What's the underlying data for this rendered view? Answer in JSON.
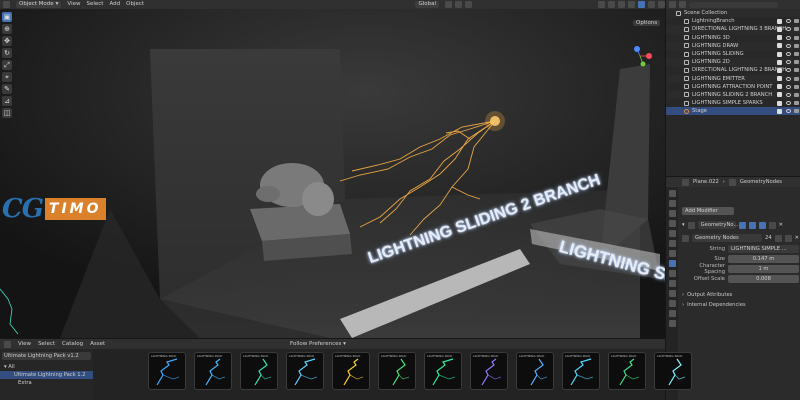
{
  "header": {
    "mode": "Object Mode",
    "menus": [
      "View",
      "Select",
      "Add",
      "Object"
    ],
    "orientation": "Global",
    "options": "Options"
  },
  "viewport": {
    "signs": [
      "LIGHTNING SLIDING 2 BRANCH",
      "LIGHTNING SI"
    ],
    "logo": {
      "cg": "CG",
      "timo": "TIMO"
    },
    "accent_colors": {
      "lightning": "#ffb347",
      "sign_glow": "#9ec3ff",
      "logo_blue": "#2a6fb0",
      "logo_orange": "#d9822b"
    }
  },
  "outliner": {
    "root": "Scene Collection",
    "items": [
      {
        "label": "LightningBranch"
      },
      {
        "label": "DIRECTIONAL LIGHTNING 3 BRANCH"
      },
      {
        "label": "LIGHTNING 3D"
      },
      {
        "label": "LIGHTNING DRAW"
      },
      {
        "label": "LIGHTNING SLIDING"
      },
      {
        "label": "LIGHTNING 2D"
      },
      {
        "label": "DIRECTIONAL LIGHTNING 2 BRANCH"
      },
      {
        "label": "LIGHTNING EMITTER"
      },
      {
        "label": "LIGHTNING ATTRACTION POINT"
      },
      {
        "label": "LIGHTNING SLIDING 2 BRANCH"
      },
      {
        "label": "LIGHTNING SIMPLE SPARKS"
      },
      {
        "label": "Stage"
      }
    ],
    "selected_index": 11
  },
  "properties": {
    "object": "Plane.022",
    "modifier_tab": "GeometryNodes",
    "add_modifier": "Add Modifier",
    "modifier_name": "GeometryNo...",
    "node_group": "Geometry Nodes",
    "users": "24",
    "fields": [
      {
        "label": "String",
        "value": "LIGHTNING SIMPLE ..."
      },
      {
        "label": "Size",
        "value": "0.147 m"
      },
      {
        "label": "Character Spacing",
        "value": "1 m"
      },
      {
        "label": "Offset Scale",
        "value": "0.008"
      }
    ],
    "panels": [
      "Output Attributes",
      "Internal Dependencies"
    ]
  },
  "asset_browser": {
    "menus": [
      "View",
      "Select",
      "Catalog",
      "Asset"
    ],
    "follow": "Follow Preferences",
    "library": "Ultimate Lightning Pack v1.2",
    "tree": [
      "All",
      "Ultimate Lightning Pack 1.2",
      "Extra"
    ],
    "selected_tree_index": 1,
    "thumb_header": "LIGHTNING PACK",
    "thumb_colors": [
      "#3fa9ff",
      "#44b8ff",
      "#36e0b0",
      "#5ad1ff",
      "#ffcc33",
      "#47e07a",
      "#2fe89a",
      "#8c7bff",
      "#57b0ff",
      "#4fd8ff",
      "#3fe080",
      "#7ef0ff"
    ]
  }
}
